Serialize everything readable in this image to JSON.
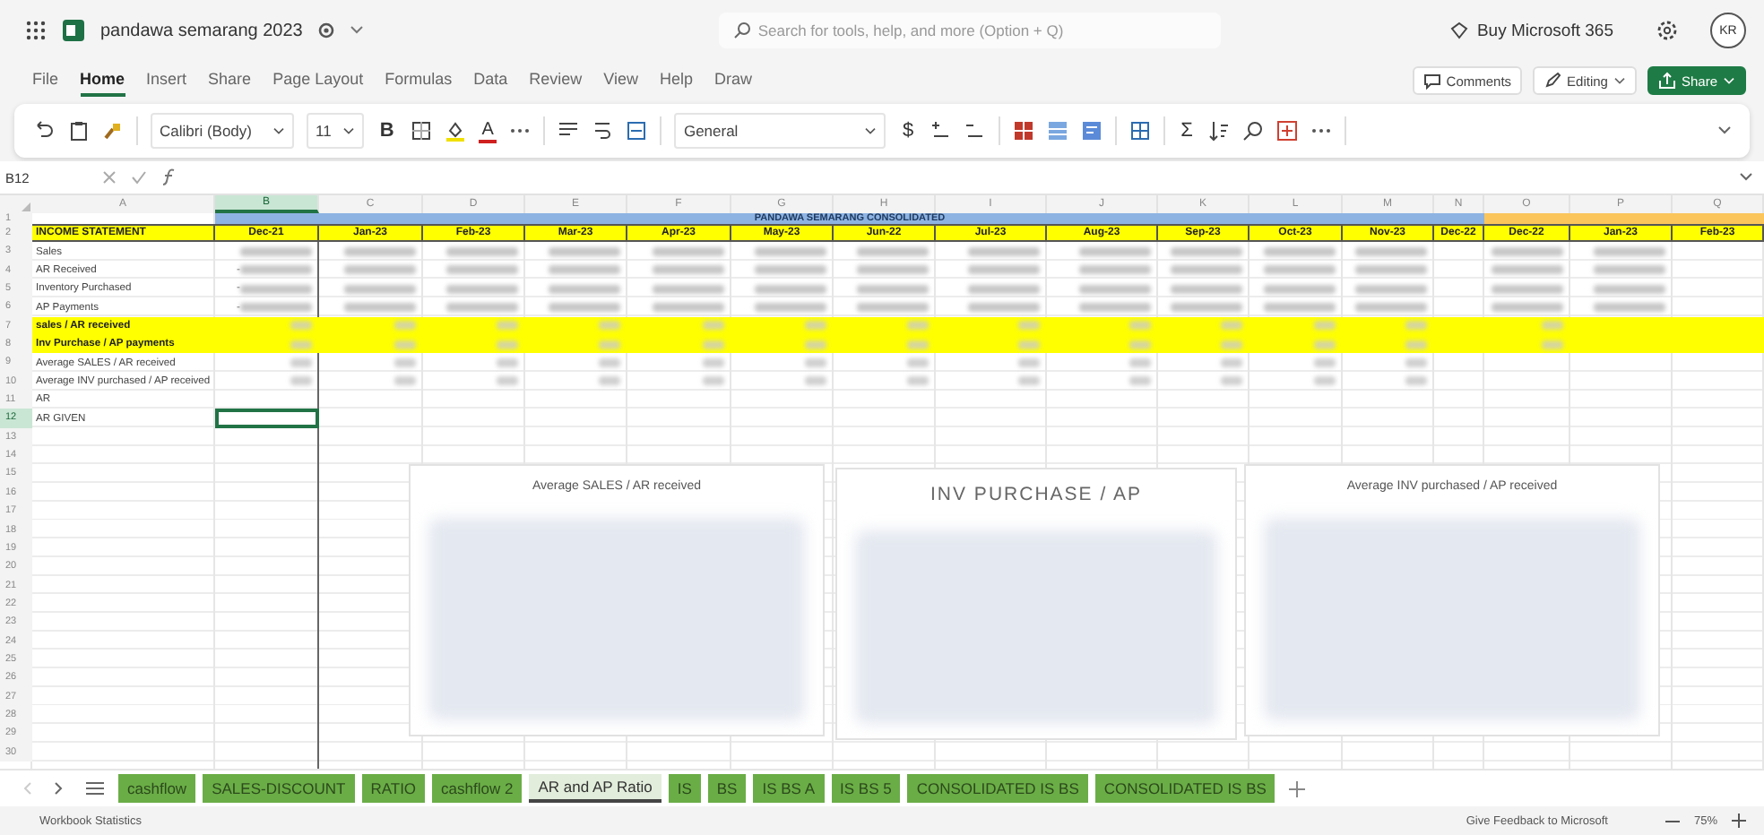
{
  "title_bar": {
    "doc_title": "pandawa semarang 2023",
    "search_placeholder": "Search for tools, help, and more (Option + Q)",
    "buy_label": "Buy Microsoft 365",
    "avatar": "KR"
  },
  "menu": [
    {
      "label": "File",
      "selected": false
    },
    {
      "label": "Home",
      "selected": true
    },
    {
      "label": "Insert",
      "selected": false
    },
    {
      "label": "Share",
      "selected": false
    },
    {
      "label": "Page Layout",
      "selected": false
    },
    {
      "label": "Formulas",
      "selected": false
    },
    {
      "label": "Data",
      "selected": false
    },
    {
      "label": "Review",
      "selected": false
    },
    {
      "label": "View",
      "selected": false
    },
    {
      "label": "Help",
      "selected": false
    },
    {
      "label": "Draw",
      "selected": false
    }
  ],
  "header_buttons": [
    {
      "kind": "comments",
      "label": "Comments"
    },
    {
      "kind": "editing",
      "label": "Editing"
    },
    {
      "kind": "share",
      "label": "Share"
    }
  ],
  "toolbar": [
    {
      "kind": "undo"
    },
    {
      "kind": "paste"
    },
    {
      "kind": "painter"
    },
    {
      "kind": "sep"
    },
    {
      "kind": "font",
      "value": "Calibri (Body)"
    },
    {
      "kind": "size",
      "value": "11"
    },
    {
      "kind": "bold",
      "text": "B"
    },
    {
      "kind": "borders"
    },
    {
      "kind": "fill"
    },
    {
      "kind": "fontcolor",
      "text": "A"
    },
    {
      "kind": "more"
    },
    {
      "kind": "sep"
    },
    {
      "kind": "align"
    },
    {
      "kind": "wrap"
    },
    {
      "kind": "merge"
    },
    {
      "kind": "sep"
    },
    {
      "kind": "numfmt",
      "value": "General"
    },
    {
      "kind": "currency",
      "text": "$"
    },
    {
      "kind": "decinc"
    },
    {
      "kind": "decdec"
    },
    {
      "kind": "sep"
    },
    {
      "kind": "condfmt"
    },
    {
      "kind": "table"
    },
    {
      "kind": "styles"
    },
    {
      "kind": "sep"
    },
    {
      "kind": "cells"
    },
    {
      "kind": "sep"
    },
    {
      "kind": "sum",
      "text": "Σ"
    },
    {
      "kind": "sort"
    },
    {
      "kind": "find"
    },
    {
      "kind": "addins"
    },
    {
      "kind": "more"
    },
    {
      "kind": "sep"
    },
    {
      "kind": "collapse"
    }
  ],
  "formula_bar": {
    "cell_ref": "B12"
  },
  "sheet": {
    "columns": [
      {
        "letter": "A",
        "selected": false
      },
      {
        "letter": "B",
        "selected": true
      },
      {
        "letter": "C",
        "selected": false
      },
      {
        "letter": "D",
        "selected": false
      },
      {
        "letter": "E",
        "selected": false
      },
      {
        "letter": "F",
        "selected": false
      },
      {
        "letter": "G",
        "selected": false
      },
      {
        "letter": "H",
        "selected": false
      },
      {
        "letter": "I",
        "selected": false
      },
      {
        "letter": "J",
        "selected": false
      },
      {
        "letter": "K",
        "selected": false
      },
      {
        "letter": "L",
        "selected": false
      },
      {
        "letter": "M",
        "selected": false
      },
      {
        "letter": "N",
        "selected": false
      },
      {
        "letter": "O",
        "selected": false
      },
      {
        "letter": "P",
        "selected": false
      },
      {
        "letter": "Q",
        "selected": false
      }
    ],
    "banner": "PANDAWA SEMARANG CONSOLIDATED",
    "header_cells": [
      "INCOME STATEMENT",
      "Dec-21",
      "Jan-23",
      "Feb-23",
      "Mar-23",
      "Apr-23",
      "May-23",
      "Jun-22",
      "Jul-23",
      "Aug-23",
      "Sep-23",
      "Oct-23",
      "Nov-23",
      "Dec-22",
      "Dec-22",
      "Jan-23",
      "Feb-23"
    ],
    "rows": [
      {
        "num": "1",
        "kind": "banner",
        "selected": false
      },
      {
        "num": "2",
        "kind": "header",
        "selected": false
      },
      {
        "num": "3",
        "kind": "data",
        "label": "Sales",
        "selected": false
      },
      {
        "num": "4",
        "kind": "data",
        "label": "AR Received",
        "b": "-",
        "selected": false
      },
      {
        "num": "5",
        "kind": "data",
        "label": "Inventory Purchased",
        "b": "-",
        "selected": false
      },
      {
        "num": "6",
        "kind": "data",
        "label": "AP Payments",
        "b": "-",
        "selected": false
      },
      {
        "num": "7",
        "kind": "highlight",
        "label": "sales / AR received",
        "selected": false
      },
      {
        "num": "8",
        "kind": "highlight",
        "label": "Inv Purchase / AP payments",
        "selected": false
      },
      {
        "num": "9",
        "kind": "average",
        "label": "Average SALES / AR received",
        "selected": false
      },
      {
        "num": "10",
        "kind": "average",
        "label": "Average INV purchased  / AP received",
        "selected": false
      },
      {
        "num": "11",
        "kind": "plain",
        "label": "AR",
        "selected": false
      },
      {
        "num": "12",
        "kind": "plain",
        "label": "AR GIVEN",
        "selected": true
      },
      {
        "num": "13",
        "kind": "empty",
        "selected": false
      },
      {
        "num": "14",
        "kind": "empty",
        "selected": false
      },
      {
        "num": "15",
        "kind": "empty",
        "selected": false
      },
      {
        "num": "16",
        "kind": "empty",
        "selected": false
      },
      {
        "num": "17",
        "kind": "empty",
        "selected": false
      },
      {
        "num": "18",
        "kind": "empty",
        "selected": false
      },
      {
        "num": "19",
        "kind": "empty",
        "selected": false
      },
      {
        "num": "20",
        "kind": "empty",
        "selected": false
      },
      {
        "num": "21",
        "kind": "empty",
        "selected": false
      },
      {
        "num": "22",
        "kind": "empty",
        "selected": false
      },
      {
        "num": "23",
        "kind": "empty",
        "selected": false
      },
      {
        "num": "24",
        "kind": "empty",
        "selected": false
      },
      {
        "num": "25",
        "kind": "empty",
        "selected": false
      },
      {
        "num": "26",
        "kind": "empty",
        "selected": false
      },
      {
        "num": "27",
        "kind": "empty",
        "selected": false
      },
      {
        "num": "28",
        "kind": "empty",
        "selected": false
      },
      {
        "num": "29",
        "kind": "empty",
        "selected": false
      },
      {
        "num": "30",
        "kind": "empty",
        "selected": false
      }
    ],
    "charts": [
      {
        "kind": "small",
        "title": "Average SALES / AR received"
      },
      {
        "kind": "large",
        "title": "INV PURCHASE / AP"
      },
      {
        "kind": "small",
        "title": "Average INV purchased  / AP received"
      }
    ]
  },
  "sheet_tabs": [
    {
      "label": "cashflow",
      "selected": false
    },
    {
      "label": "SALES-DISCOUNT",
      "selected": false
    },
    {
      "label": "RATIO",
      "selected": false
    },
    {
      "label": "cashflow 2",
      "selected": false
    },
    {
      "label": "AR and AP Ratio",
      "selected": true
    },
    {
      "label": "IS",
      "selected": false
    },
    {
      "label": "BS",
      "selected": false
    },
    {
      "label": "IS BS A",
      "selected": false
    },
    {
      "label": "IS BS 5",
      "selected": false
    },
    {
      "label": "CONSOLIDATED IS BS",
      "selected": false
    },
    {
      "label": "CONSOLIDATED IS BS",
      "selected": false
    }
  ],
  "status_bar": {
    "left": "Workbook Statistics",
    "feedback": "Give Feedback to Microsoft",
    "zoom": "75%"
  }
}
